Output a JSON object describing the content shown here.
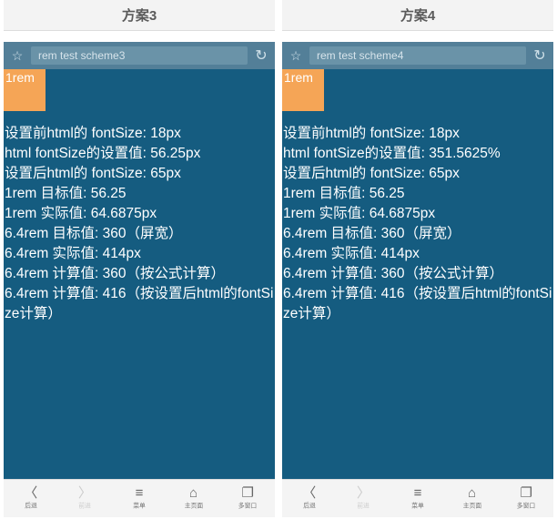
{
  "columns": {
    "left": {
      "header": "方案3",
      "url": "rem test scheme3",
      "box": "1rem",
      "lines": [
        "设置前html的 fontSize: 18px",
        "html fontSize的设置值: 56.25px",
        "设置后html的 fontSize: 65px",
        "1rem 目标值: 56.25",
        "1rem 实际值: 64.6875px",
        "6.4rem 目标值: 360（屏宽）",
        "6.4rem 实际值: 414px",
        "6.4rem 计算值: 360（按公式计算）",
        "6.4rem 计算值: 416（按设置后html的fontSize计算）"
      ]
    },
    "right": {
      "header": "方案4",
      "url": "rem test scheme4",
      "box": "1rem",
      "lines": [
        "设置前html的 fontSize: 18px",
        "html fontSize的设置值: 351.5625%",
        "设置后html的 fontSize: 65px",
        "1rem 目标值: 56.25",
        "1rem 实际值: 64.6875px",
        "6.4rem 目标值: 360（屏宽）",
        "6.4rem 实际值: 414px",
        "6.4rem 计算值: 360（按公式计算）",
        "6.4rem 计算值: 416（按设置后html的fontSize计算）"
      ]
    }
  },
  "nav": {
    "back": "后退",
    "forward": "前进",
    "menu": "菜单",
    "home": "主页面",
    "windows": "多窗口"
  }
}
